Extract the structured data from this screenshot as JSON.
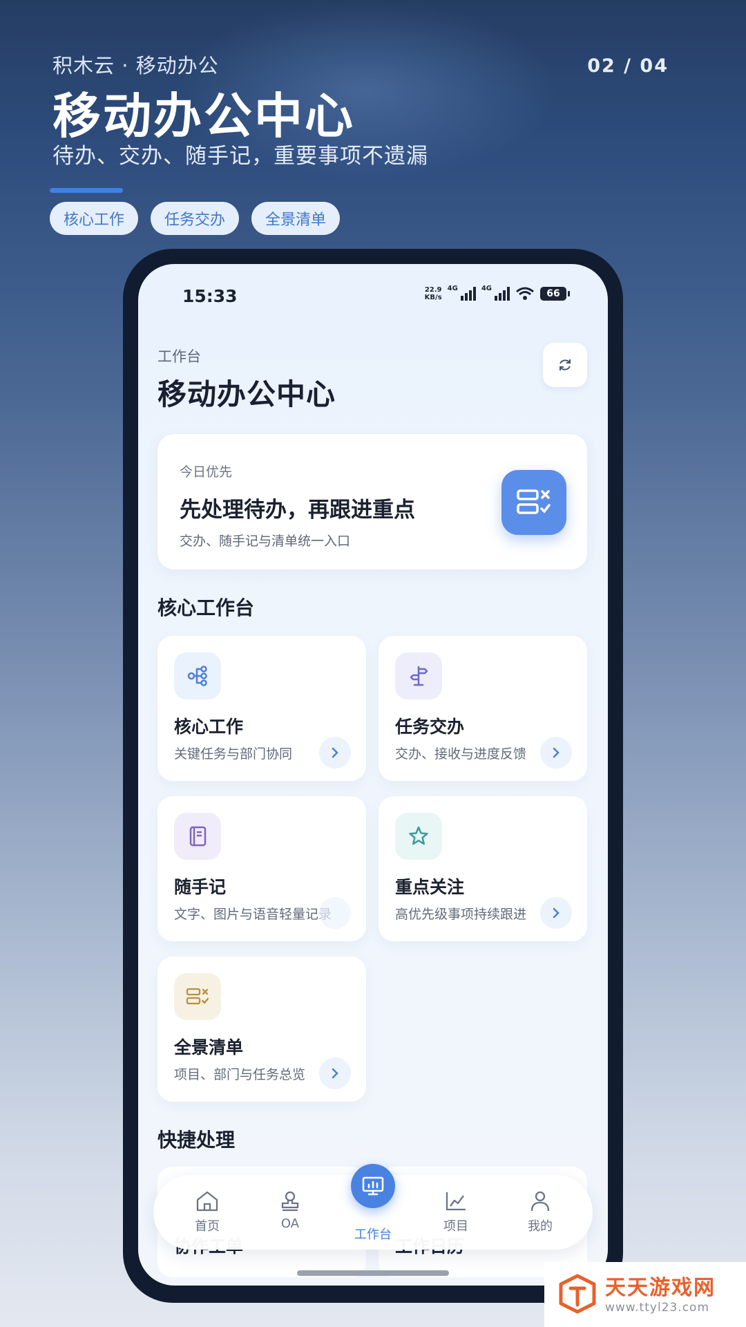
{
  "header": {
    "brand": "积木云 · 移动办公",
    "page_indicator": "02 / 04",
    "title": "移动办公中心",
    "subtitle": "待办、交办、随手记，重要事项不遗漏",
    "tags": [
      "核心工作",
      "任务交办",
      "全景清单"
    ]
  },
  "status_bar": {
    "time": "15:33",
    "speed_value": "22.9",
    "speed_unit": "KB/s",
    "net1": "4G",
    "net2": "4G",
    "battery": "66"
  },
  "screen": {
    "breadcrumb": "工作台",
    "title": "移动办公中心",
    "priority": {
      "kicker": "今日优先",
      "headline": "先处理待办，再跟进重点",
      "desc": "交办、随手记与清单统一入口"
    },
    "core_section_title": "核心工作台",
    "cards": [
      {
        "title": "核心工作",
        "desc": "关键任务与部门协同",
        "icon": "flow-icon",
        "color": "#4a7fd6",
        "bg": "#eaf2fd"
      },
      {
        "title": "任务交办",
        "desc": "交办、接收与进度反馈",
        "icon": "signpost-icon",
        "color": "#6a6cc4",
        "bg": "#eeedfb"
      },
      {
        "title": "随手记",
        "desc": "文字、图片与语音轻量记录",
        "icon": "notebook-icon",
        "color": "#7a67b8",
        "bg": "#f0ecfa"
      },
      {
        "title": "重点关注",
        "desc": "高优先级事项持续跟进",
        "icon": "star-icon",
        "color": "#3f9a98",
        "bg": "#e8f6f5"
      },
      {
        "title": "全景清单",
        "desc": "项目、部门与任务总览",
        "icon": "checklist-icon",
        "color": "#b8913f",
        "bg": "#f7f1e4"
      }
    ],
    "quick_section_title": "快捷处理",
    "quick_items": [
      "协作工单",
      "工作日历"
    ]
  },
  "tabbar": {
    "items": [
      "首页",
      "OA",
      "工作台",
      "项目",
      "我的"
    ],
    "active": "工作台"
  },
  "watermark": {
    "name": "天天游戏网",
    "url": "www.ttyl23.com"
  }
}
